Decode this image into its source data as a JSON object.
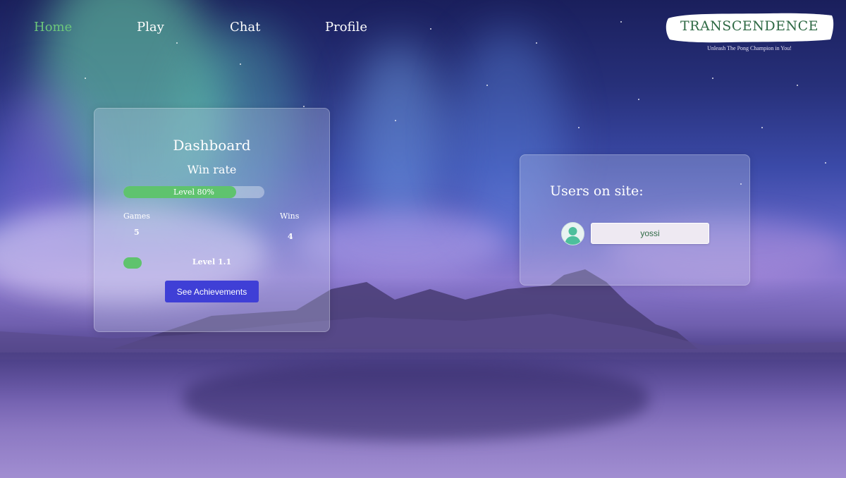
{
  "nav": {
    "items": [
      {
        "label": "Home",
        "active": true
      },
      {
        "label": "Play",
        "active": false
      },
      {
        "label": "Chat",
        "active": false
      },
      {
        "label": "Profile",
        "active": false
      }
    ]
  },
  "brand": {
    "title": "TRANSCENDENCE",
    "tagline": "Unleash The Pong Champion in You!"
  },
  "dashboard": {
    "title": "Dashboard",
    "win_rate_title": "Win rate",
    "win_rate_bar_label": "Level 80%",
    "win_rate_fraction": 0.8,
    "games_label": "Games",
    "games_value": "5",
    "wins_label": "Wins",
    "wins_value": "4",
    "level_label": "Level 1.1",
    "achievements_button": "See Achievements"
  },
  "users_panel": {
    "title": "Users on site:",
    "users": [
      {
        "name": "yossi",
        "avatar": "user-avatar-icon"
      }
    ]
  },
  "colors": {
    "active_nav": "#6cc77a",
    "progress_green": "#5fc36e",
    "button_blue": "#3f3fd6",
    "brand_green": "#2f6a45"
  }
}
